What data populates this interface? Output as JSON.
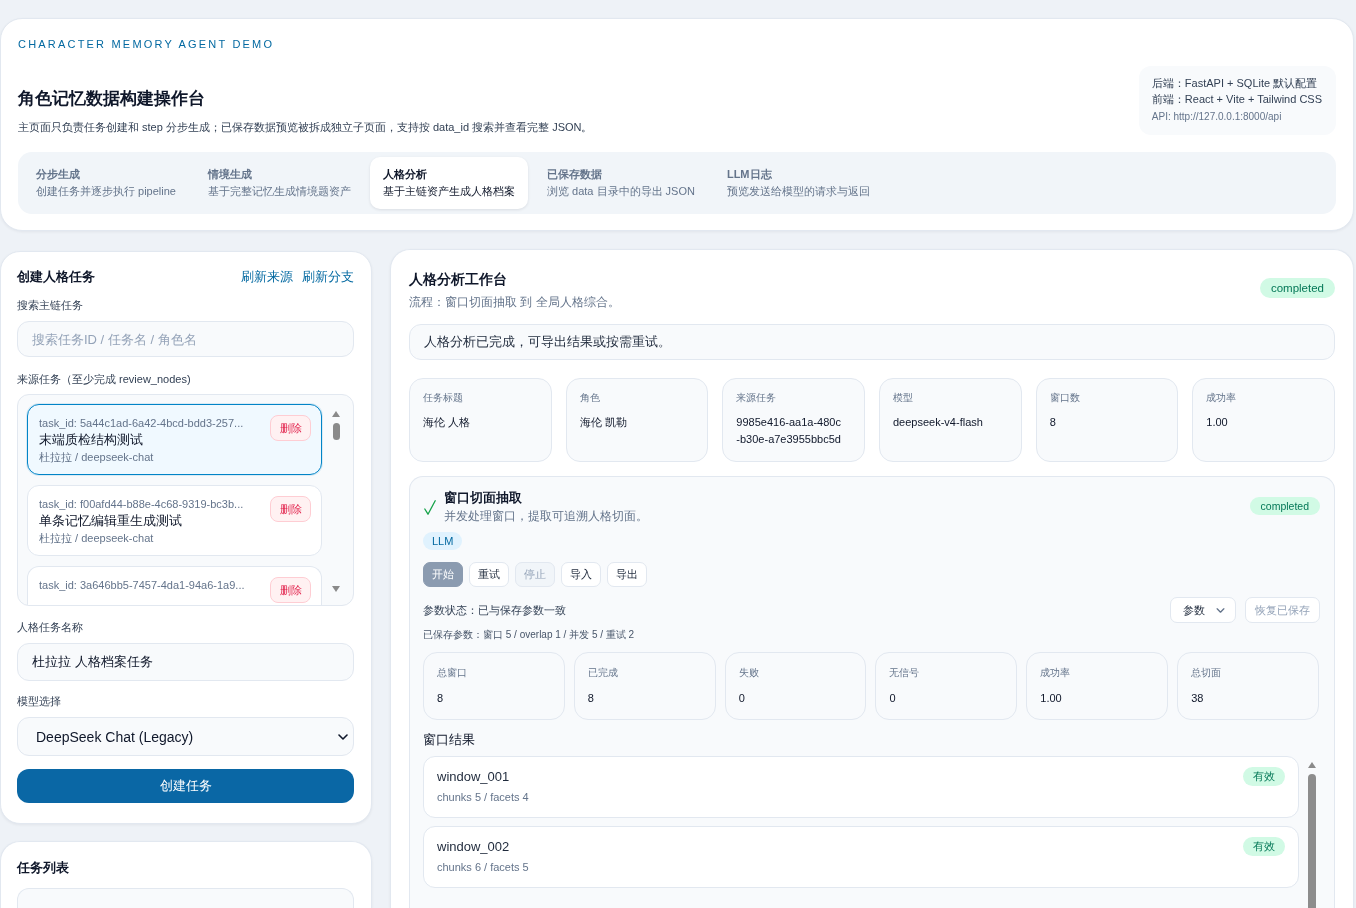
{
  "header": {
    "eyebrow": "CHARACTER MEMORY AGENT DEMO",
    "title": "角色记忆数据构建操作台",
    "subtitle": "主页面只负责任务创建和 step 分步生成；已保存数据预览被拆成独立子页面，支持按 data_id 搜索并查看完整 JSON。",
    "stack": [
      "后端：FastAPI + SQLite 默认配置",
      "前端：React + Vite + Tailwind CSS"
    ],
    "api": "API: http://127.0.0.1:8000/api"
  },
  "tabs": [
    {
      "title": "分步生成",
      "description": "创建任务并逐步执行 pipeline",
      "selected": false
    },
    {
      "title": "情境生成",
      "description": "基于完整记忆生成情境题资产",
      "selected": false
    },
    {
      "title": "人格分析",
      "description": "基于主链资产生成人格档案",
      "selected": true
    },
    {
      "title": "已保存数据",
      "description": "浏览 data 目录中的导出 JSON",
      "selected": false
    },
    {
      "title": "LLM日志",
      "description": "预览发送给模型的请求与返回",
      "selected": false
    }
  ],
  "create_panel": {
    "title": "创建人格任务",
    "links": [
      "刷新来源",
      "刷新分支"
    ],
    "search_label": "搜索主链任务",
    "search": {
      "placeholder": "搜索任务ID / 任务名 / 角色名"
    },
    "source_label": "来源任务（至少完成 review_nodes)",
    "sources": [
      {
        "task_id": "task_id: 5a44c1ad-6a42-4bcd-bdd3-257...",
        "title": "末端质检结构测试",
        "meta": "杜拉拉 / deepseek-chat",
        "delete": "删除",
        "selected": true
      },
      {
        "task_id": "task_id: f00afd44-b88e-4c68-9319-bc3b...",
        "title": "单条记忆编辑重生成测试",
        "meta": "杜拉拉 / deepseek-chat",
        "delete": "删除",
        "selected": false
      },
      {
        "task_id": "task_id: 3a646bb5-7457-4da1-94a6-1a9...",
        "delete": "删除",
        "selected": false
      }
    ],
    "name_label": "人格任务名称",
    "name_field": {
      "value": "杜拉拉 人格档案任务"
    },
    "model_label": "模型选择",
    "model_select": {
      "value": "DeepSeek Chat (Legacy)"
    },
    "submit": "创建任务"
  },
  "task_list_panel": {
    "title": "任务列表"
  },
  "workbench": {
    "title": "人格分析工作台",
    "subtitle": "流程：窗口切面抽取 到 全局人格综合。",
    "status": "completed",
    "notice": "人格分析已完成，可导出结果或按需重试。",
    "info": [
      {
        "label": "任务标题",
        "value": "海伦 人格"
      },
      {
        "label": "角色",
        "value": "海伦 凯勒"
      },
      {
        "label": "来源任务",
        "value": "9985e416-aa1a-480c-b30e-a7e3955bbc5d"
      },
      {
        "label": "模型",
        "value": "deepseek-v4-flash"
      },
      {
        "label": "窗口数",
        "value": "8"
      },
      {
        "label": "成功率",
        "value": "1.00"
      }
    ],
    "stage": {
      "title": "窗口切面抽取",
      "description": "并发处理窗口，提取可追溯人格切面。",
      "completed": true,
      "status": "completed",
      "tag": "LLM",
      "buttons": [
        {
          "label": "开始",
          "kind": "primary",
          "disabled": true
        },
        {
          "label": "重试",
          "kind": "default",
          "disabled": false
        },
        {
          "label": "停止",
          "kind": "default",
          "disabled": true
        },
        {
          "label": "导入",
          "kind": "default",
          "disabled": false
        },
        {
          "label": "导出",
          "kind": "default",
          "disabled": false
        }
      ],
      "param_status": "参数状态：已与保存参数一致",
      "params_menu": "参数",
      "restore": {
        "label": "恢复已保存",
        "disabled": true
      },
      "saved_params": "已保存参数：窗口 5 / overlap 1 / 并发 5 / 重试 2",
      "stats": [
        {
          "label": "总窗口",
          "value": "8"
        },
        {
          "label": "已完成",
          "value": "8"
        },
        {
          "label": "失败",
          "value": "0"
        },
        {
          "label": "无信号",
          "value": "0"
        },
        {
          "label": "成功率",
          "value": "1.00"
        },
        {
          "label": "总切面",
          "value": "38"
        }
      ],
      "results_title": "窗口结果",
      "results": [
        {
          "name": "window_001",
          "detail": "chunks 5 / facets 4",
          "badge": "有效",
          "valid": true
        },
        {
          "name": "window_002",
          "detail": "chunks 6 / facets 5",
          "badge": "有效",
          "valid": true
        }
      ]
    }
  }
}
